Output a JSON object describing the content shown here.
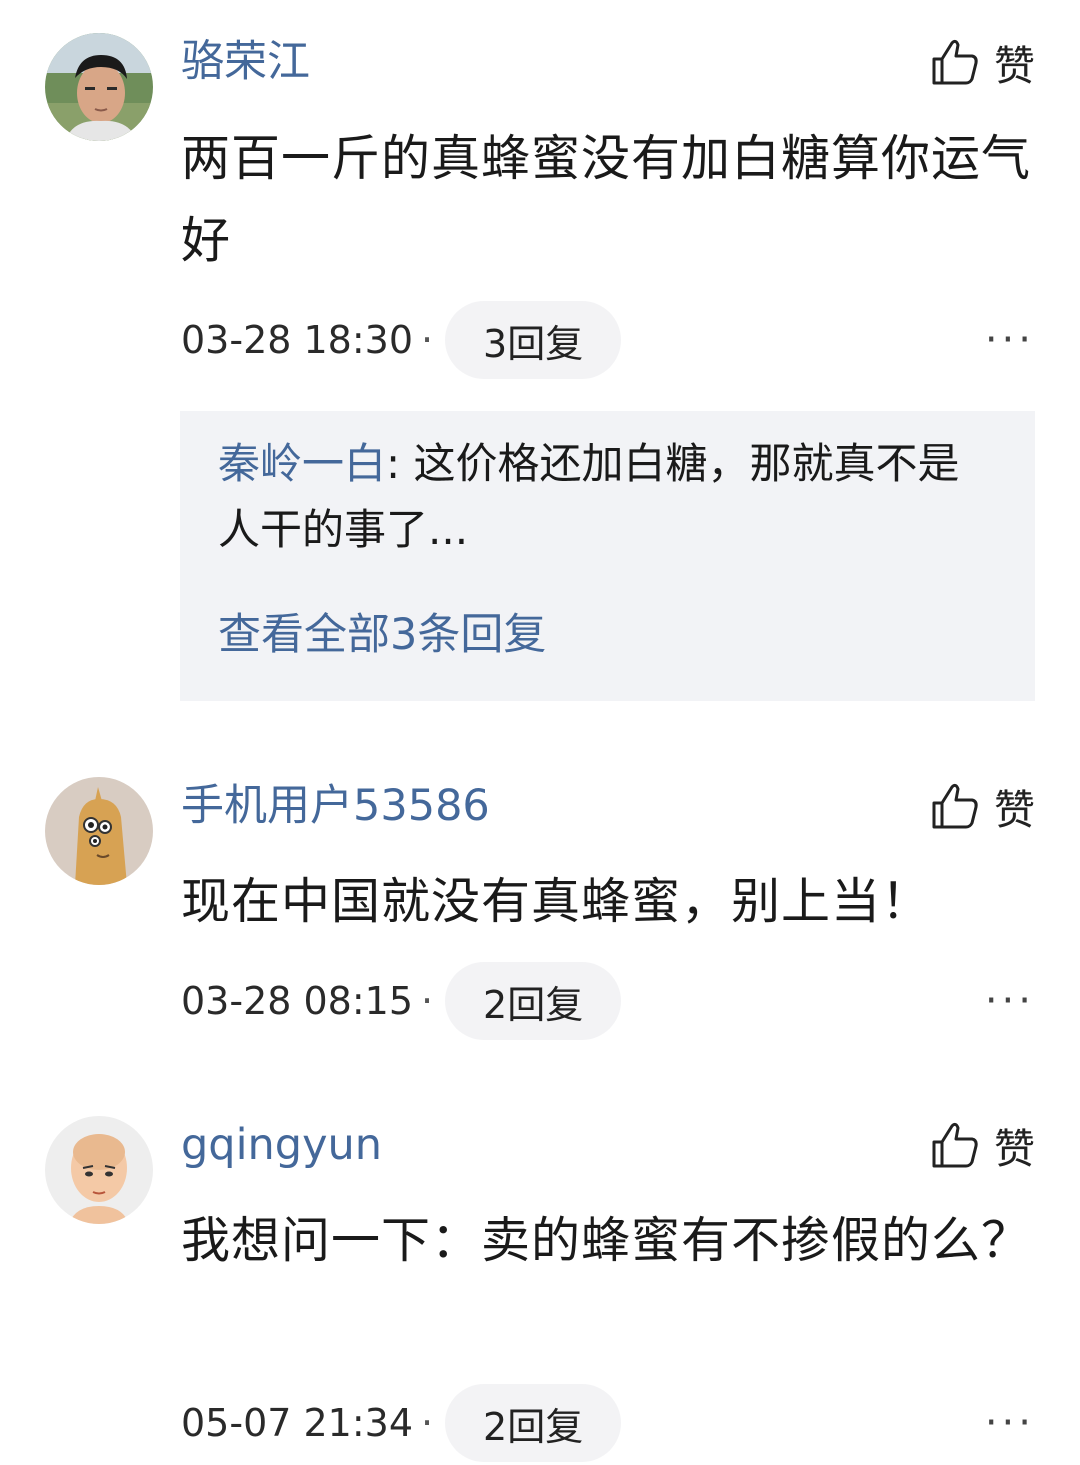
{
  "like_label": "赞",
  "more_label": "···",
  "dot_separator": "·",
  "comments": [
    {
      "username": "骆荣江",
      "text": "两百一斤的真蜂蜜没有加白糖算你运气好",
      "time": "03-28 18:30",
      "replies_label": "3回复",
      "avatar": "photo-avatar",
      "reply_preview": {
        "author": "秦岭一白",
        "colon": ": ",
        "text": "这价格还加白糖，那就真不是人干的事了...",
        "view_all": "查看全部3条回复"
      }
    },
    {
      "username": "手机用户53586",
      "text": "现在中国就没有真蜂蜜，别上当！",
      "time": "03-28 08:15",
      "replies_label": "2回复",
      "avatar": "cartoon-avatar"
    },
    {
      "username": "gqingyun",
      "text": "我想问一下：卖的蜂蜜有不掺假的么？",
      "time": "05-07 21:34",
      "replies_label": "2回复",
      "avatar": "bald-cartoon-avatar"
    }
  ]
}
